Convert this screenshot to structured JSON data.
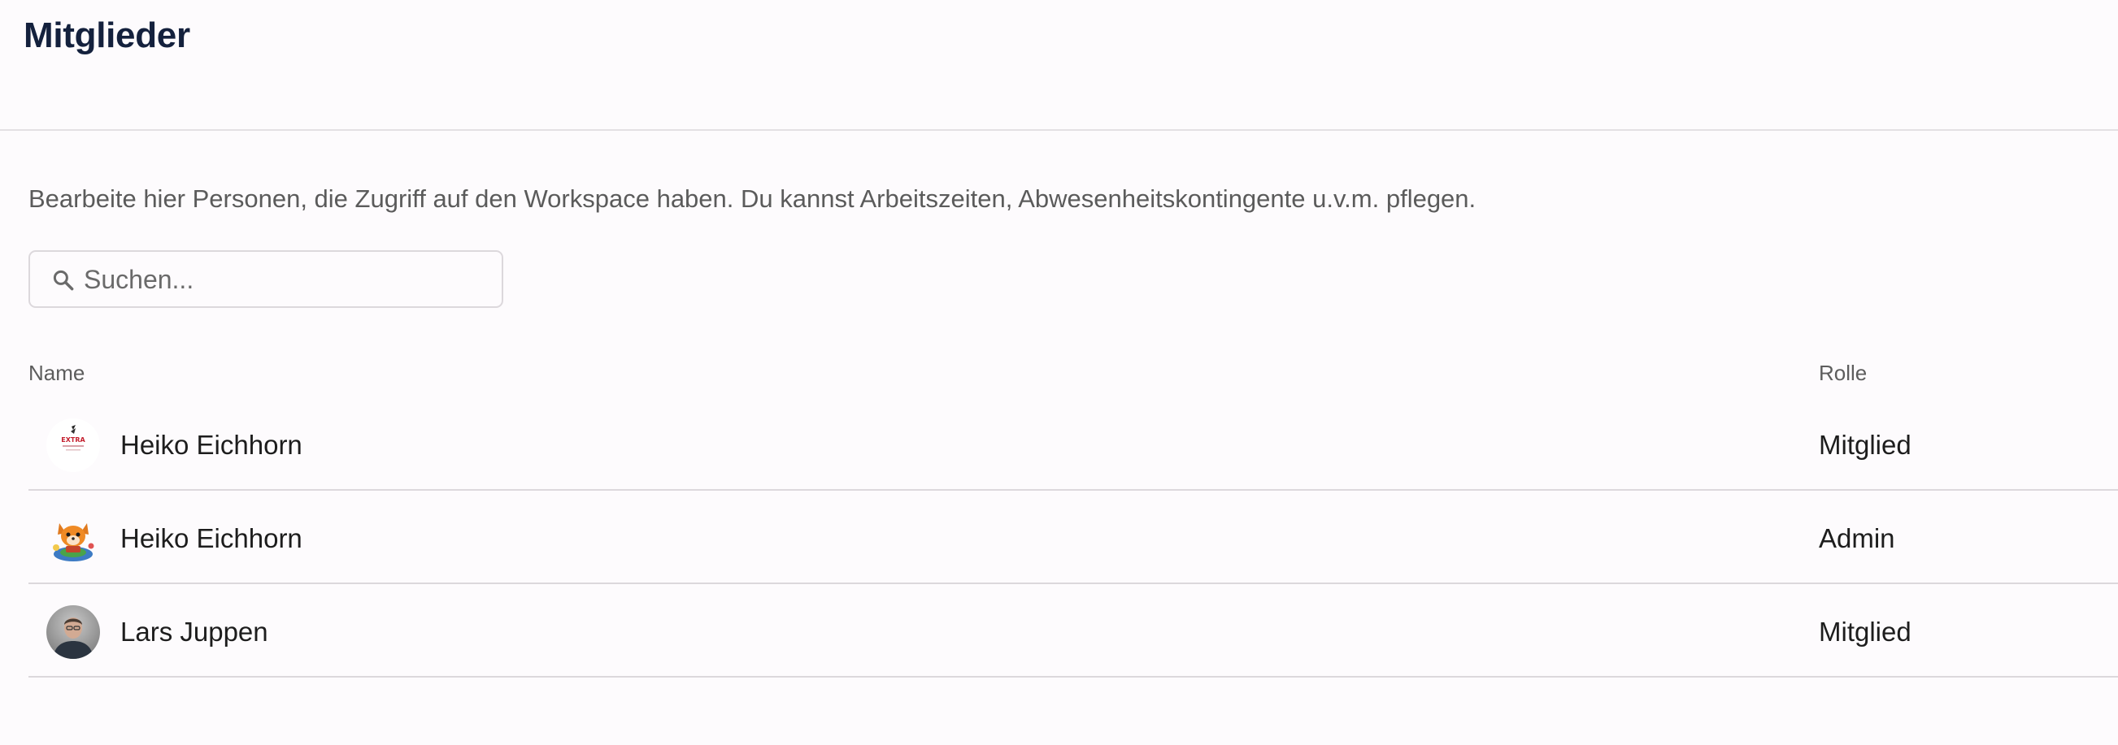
{
  "page": {
    "title": "Mitglieder",
    "description": "Bearbeite hier Personen, die Zugriff auf den Workspace haben. Du kannst Arbeitszeiten, Abwesenheitskontingente u.v.m. pflegen."
  },
  "search": {
    "placeholder": "Suchen...",
    "value": "",
    "icon": "search-icon"
  },
  "table": {
    "columns": {
      "name": "Name",
      "role": "Rolle"
    },
    "rows": [
      {
        "name": "Heiko Eichhorn",
        "role": "Mitglied",
        "avatar": "extra-logo-avatar"
      },
      {
        "name": "Heiko Eichhorn",
        "role": "Admin",
        "avatar": "fox-illustration-avatar"
      },
      {
        "name": "Lars Juppen",
        "role": "Mitglied",
        "avatar": "photo-avatar"
      }
    ]
  },
  "colors": {
    "title": "#14213d",
    "background": "#fdfbfd",
    "divider": "#dcd8dc",
    "muted_text": "#5b5b5b"
  }
}
